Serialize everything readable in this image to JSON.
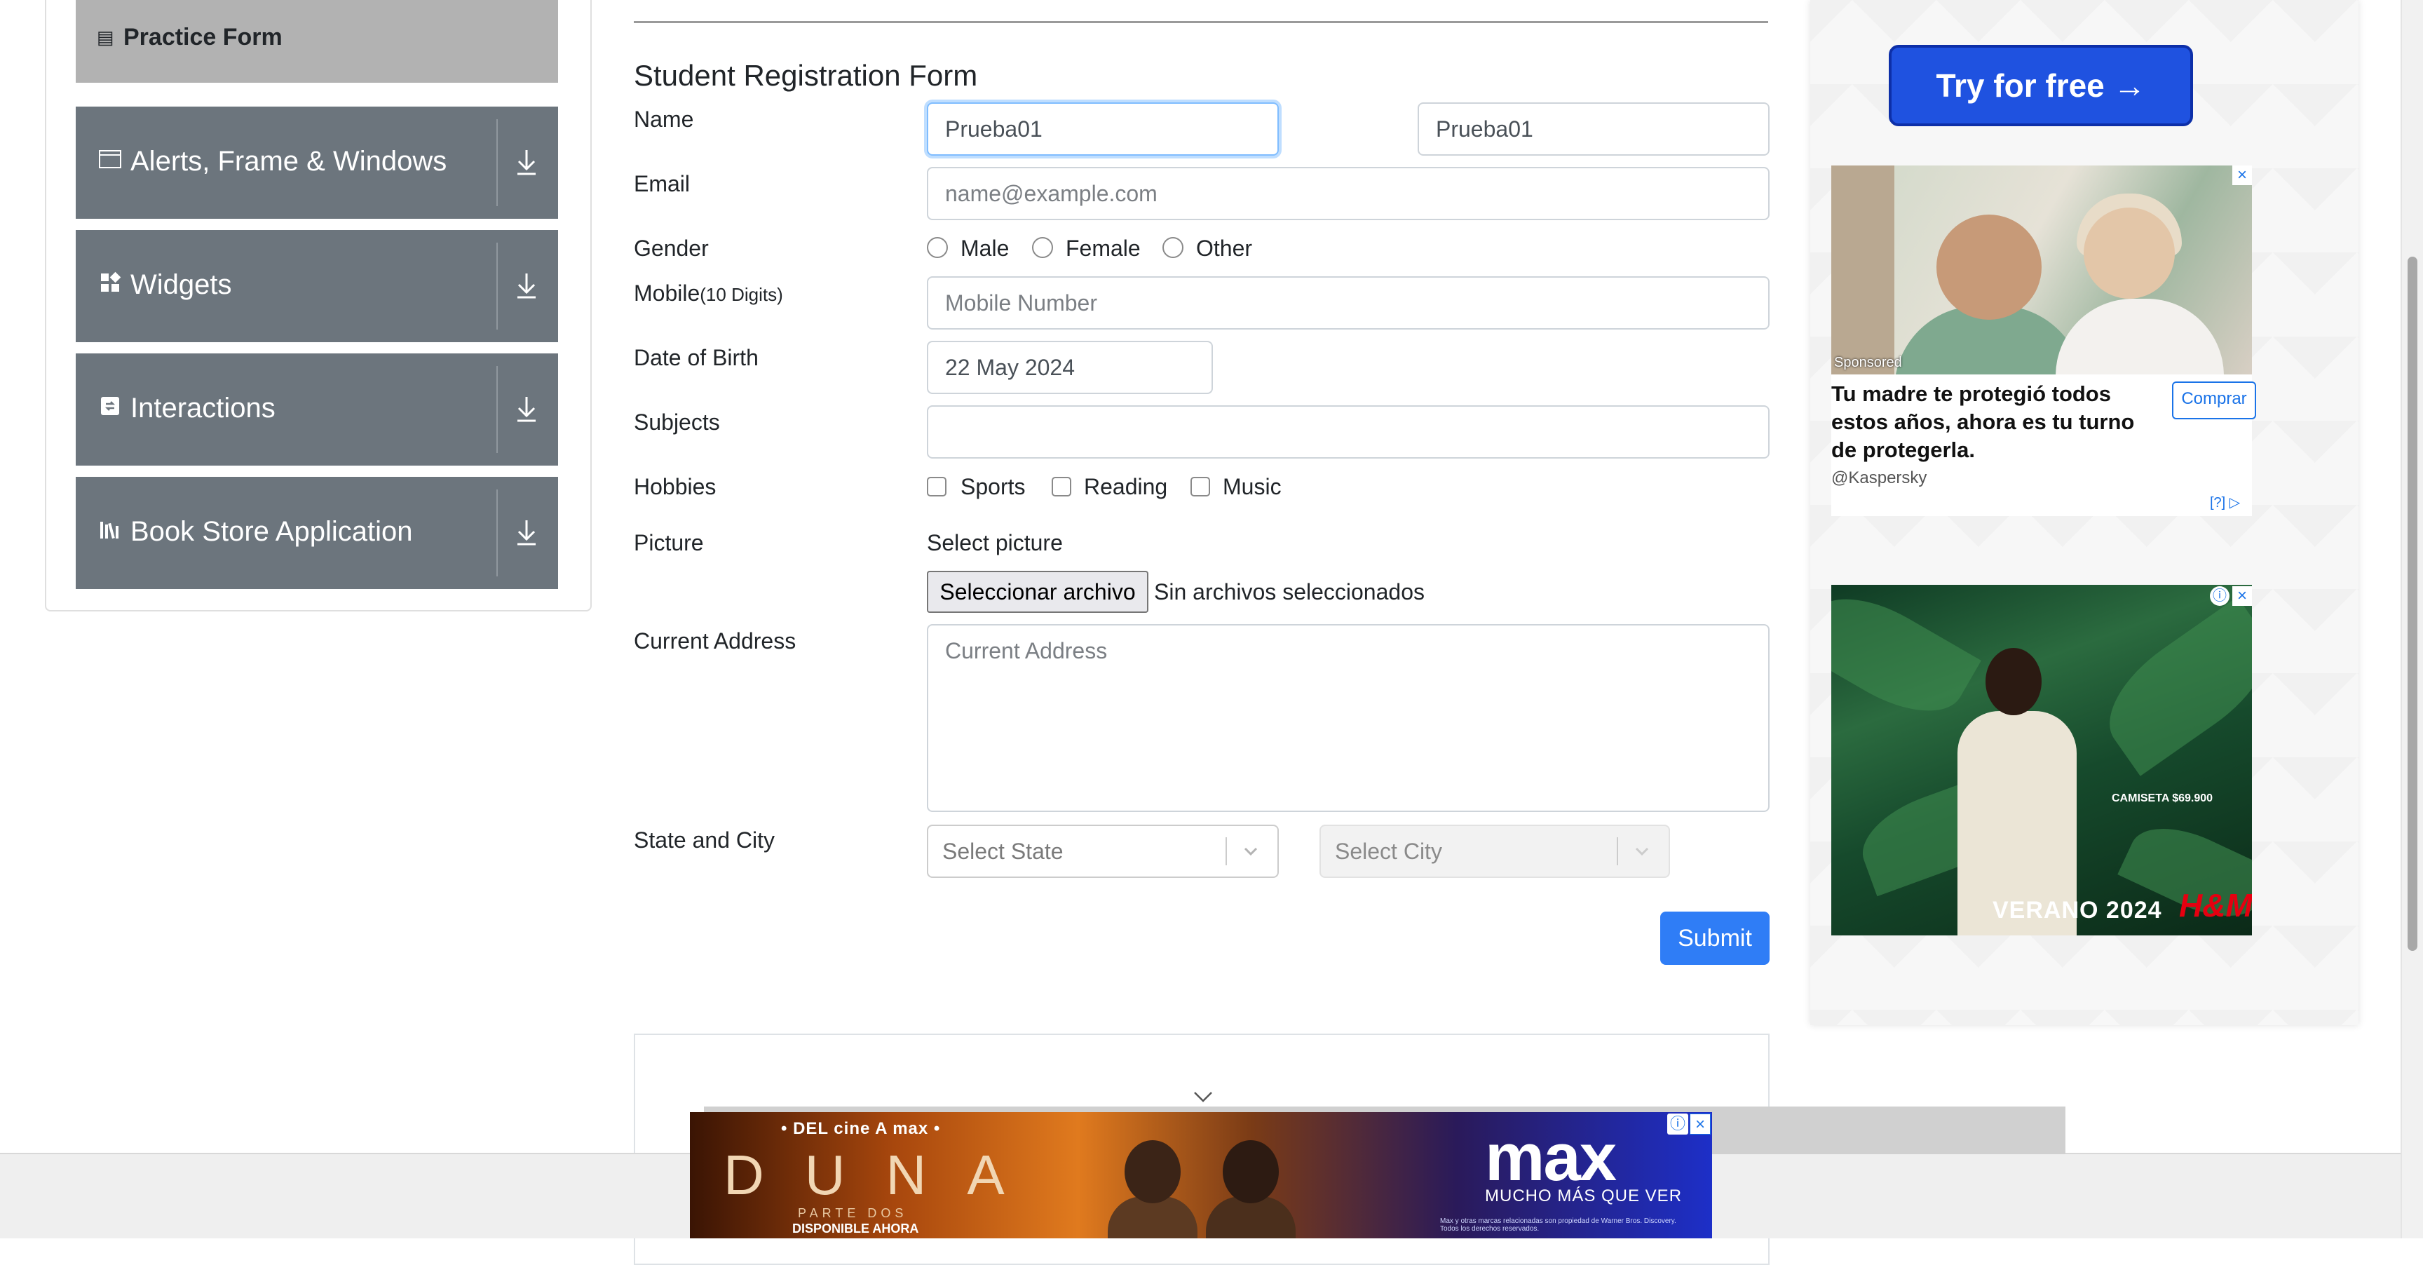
{
  "sidebar": {
    "practice_form": {
      "label": "Practice Form",
      "icon": "form-icon"
    },
    "groups": [
      {
        "label": "Alerts, Frame & Windows",
        "icon": "window-icon"
      },
      {
        "label": "Widgets",
        "icon": "widgets-icon"
      },
      {
        "label": "Interactions",
        "icon": "interactions-icon"
      },
      {
        "label": "Book Store Application",
        "icon": "library-icon"
      }
    ]
  },
  "form": {
    "title": "Student Registration Form",
    "name": {
      "label": "Name",
      "first_value": "Prueba01",
      "last_value": "Prueba01"
    },
    "email": {
      "label": "Email",
      "placeholder": "name@example.com",
      "value": ""
    },
    "gender": {
      "label": "Gender",
      "options": [
        "Male",
        "Female",
        "Other"
      ]
    },
    "mobile": {
      "label": "Mobile",
      "hint": "(10 Digits)",
      "placeholder": "Mobile Number"
    },
    "dob": {
      "label": "Date of Birth",
      "value": "22 May 2024"
    },
    "subjects": {
      "label": "Subjects",
      "value": ""
    },
    "hobbies": {
      "label": "Hobbies",
      "options": [
        "Sports",
        "Reading",
        "Music"
      ]
    },
    "picture": {
      "label": "Picture",
      "select_text": "Select picture",
      "button": "Seleccionar archivo",
      "status": "Sin archivos seleccionados"
    },
    "address": {
      "label": "Current Address",
      "placeholder": "Current Address"
    },
    "state_city": {
      "label": "State and City",
      "state_placeholder": "Select State",
      "city_placeholder": "Select City"
    },
    "submit": "Submit"
  },
  "ads": {
    "try_button": "Try for free →",
    "kaspersky": {
      "sponsored": "Sponsored",
      "headline": "Tu madre te protegió todos estos años, ahora es tu turno de protegerla.",
      "brand": "@Kaspersky",
      "cta": "Comprar",
      "adchoices": "[?]"
    },
    "hm": {
      "caption": "CAMISETA $69.900",
      "campaign": "VERANO 2024",
      "brand": "H&M"
    },
    "banner": {
      "top": "• DEL cine A max •",
      "title": "DUNA",
      "subtitle": "PARTE DOS",
      "available": "DISPONIBLE AHORA",
      "brand": "max",
      "tagline": "MUCHO MÁS QUE VER",
      "fine_print": "Max y otras marcas relacionadas son propiedad de Warner Bros. Discovery. Todos los derechos reservados."
    }
  },
  "colors": {
    "sidebar_group": "#6c757d",
    "sidebar_active": "#b2b2b2",
    "submit": "#2f7df6",
    "focus": "#80bdff"
  }
}
